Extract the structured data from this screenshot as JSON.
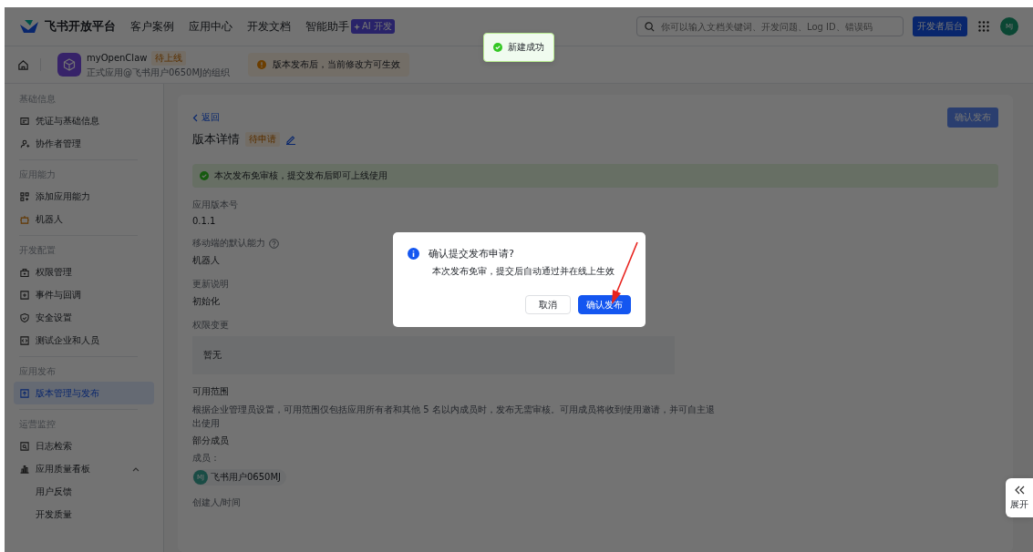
{
  "top_nav": {
    "logo": "飞书开放平台",
    "links": [
      "客户案例",
      "应用中心",
      "开发文档",
      "智能助手"
    ],
    "ai_badge": "AI 开发",
    "search": {
      "placeholder": "你可以输入文档关键词、开发问题、Log ID、错误码"
    },
    "console_button": "开发者后台",
    "avatar": "MJ"
  },
  "app_bar": {
    "app_name": "myOpenClaw",
    "status_tag": "待上线",
    "subtitle": "正式应用@飞书用户0650MJ的组织",
    "notice": "版本发布后，当前修改方可生效"
  },
  "toast": "新建成功",
  "sidebar": {
    "groups": [
      {
        "title": "基础信息",
        "items": [
          {
            "label": "凭证与基础信息",
            "kind": "card",
            "selected": false
          },
          {
            "label": "协作者管理",
            "kind": "user",
            "selected": false
          }
        ]
      },
      {
        "title": "应用能力",
        "items": [
          {
            "label": "添加应用能力",
            "kind": "grid",
            "selected": false
          },
          {
            "label": "机器人",
            "kind": "robot",
            "selected": false
          }
        ]
      },
      {
        "title": "开发配置",
        "items": [
          {
            "label": "权限管理",
            "kind": "lock",
            "selected": false
          },
          {
            "label": "事件与回调",
            "kind": "plusbox",
            "selected": false
          },
          {
            "label": "安全设置",
            "kind": "shield",
            "selected": false
          },
          {
            "label": "测试企业和人员",
            "kind": "code",
            "selected": false
          }
        ]
      },
      {
        "title": "应用发布",
        "items": [
          {
            "label": "版本管理与发布",
            "kind": "upload",
            "selected": true
          }
        ]
      },
      {
        "title": "运营监控",
        "items": [
          {
            "label": "日志检索",
            "kind": "log",
            "selected": false
          },
          {
            "label": "应用质量看板",
            "kind": "chart",
            "selected": false,
            "expanded": true,
            "children": [
              {
                "label": "用户反馈",
                "selected": false
              },
              {
                "label": "开发质量",
                "selected": false
              }
            ]
          }
        ]
      }
    ]
  },
  "content": {
    "back": "返回",
    "title": "版本详情",
    "status_tag": "待申请",
    "publish_button": "确认发布",
    "notice": "本次发布免审核，提交发布后即可上线使用",
    "fields": [
      {
        "label": "应用版本号",
        "value": "0.1.1"
      },
      {
        "label": "移动端的默认能力",
        "help": true,
        "value": "机器人"
      },
      {
        "label": "更新说明",
        "value": "初始化"
      }
    ],
    "permissions": {
      "label": "权限变更",
      "value": "暂无"
    },
    "scope": {
      "label": "可用范围",
      "description": "根据企业管理员设置，可用范围仅包括应用所有者和其他 5 名以内成员时，发布无需审核。可用成员将收到使用邀请，并可自主退出使用",
      "value": "部分成员",
      "members_label": "成员：",
      "members": [
        {
          "avatar": "MJ",
          "name": "飞书用户0650MJ"
        }
      ]
    },
    "creator_label": "创建人/时间"
  },
  "dialog": {
    "title": "确认提交发布申请?",
    "message": "本次发布免审，提交后自动通过并在线上生效",
    "cancel": "取消",
    "confirm": "确认发布"
  },
  "expand_tab": {
    "label": "展开"
  }
}
